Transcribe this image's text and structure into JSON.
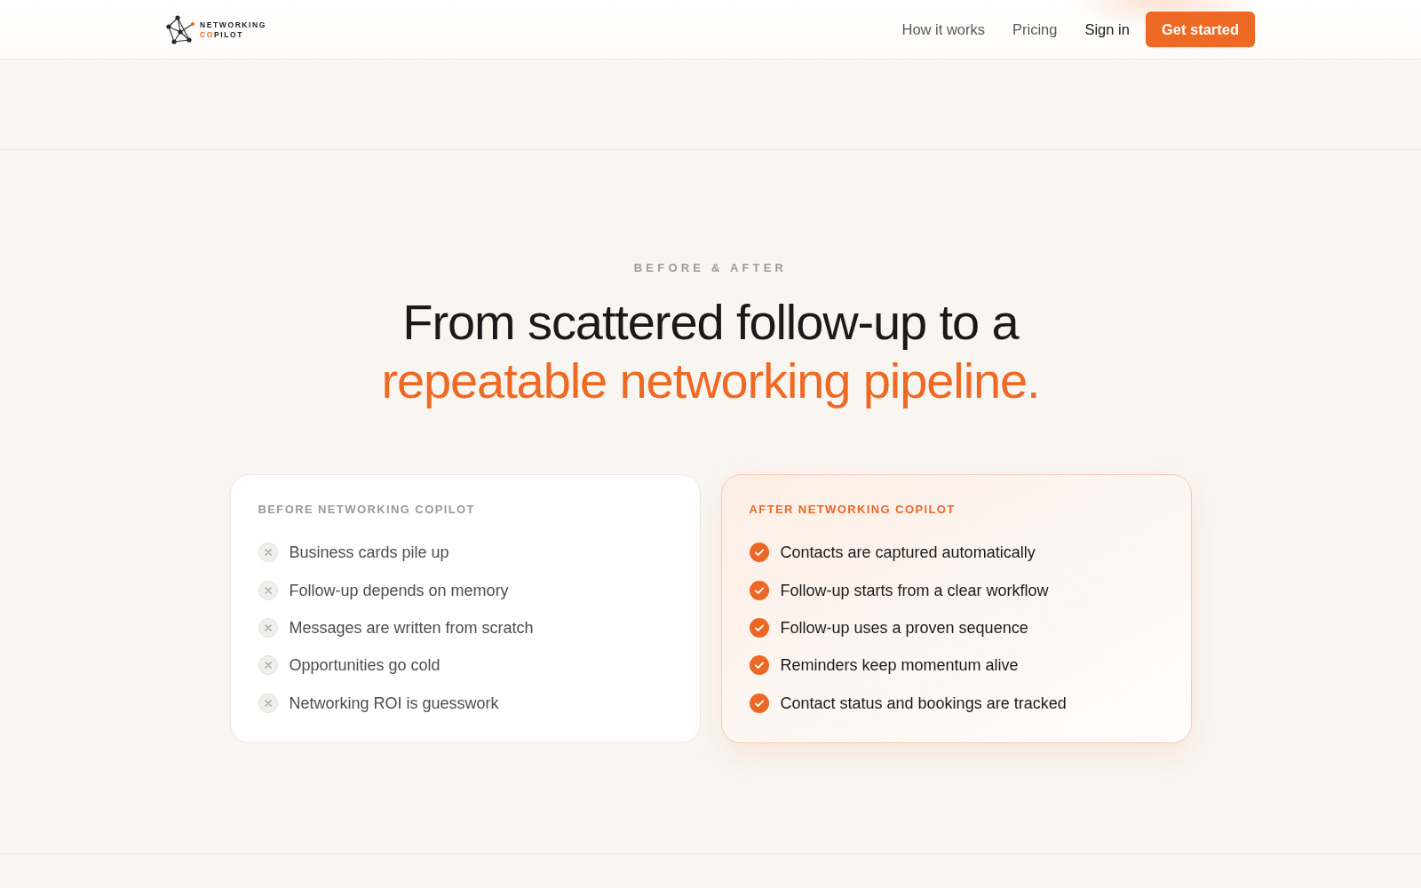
{
  "header": {
    "logo": {
      "line_1": "NETWORKING",
      "line_2_accent": "CO",
      "line_2_rest": "PILOT"
    },
    "nav": [
      {
        "label": "How it works",
        "kind": "link"
      },
      {
        "label": "Pricing",
        "kind": "link"
      },
      {
        "label": "Sign in",
        "kind": "signin"
      },
      {
        "label": "Get started",
        "kind": "cta"
      }
    ]
  },
  "section": {
    "eyebrow": "BEFORE & AFTER",
    "heading": {
      "text": "From scattered follow-up to a",
      "highlight": "repeatable networking pipeline."
    },
    "cards": [
      {
        "kind": "before",
        "title": "BEFORE NETWORKING COPILOT",
        "items": [
          "Business cards pile up",
          "Follow-up depends on memory",
          "Messages are written from scratch",
          "Opportunities go cold",
          "Networking ROI is guesswork"
        ]
      },
      {
        "kind": "after",
        "title": "AFTER NETWORKING COPILOT",
        "items": [
          "Contacts are captured automatically",
          "Follow-up starts from a clear workflow",
          "Follow-up uses a proven sequence",
          "Reminders keep momentum alive",
          "Contact status and bookings are tracked"
        ]
      }
    ]
  }
}
